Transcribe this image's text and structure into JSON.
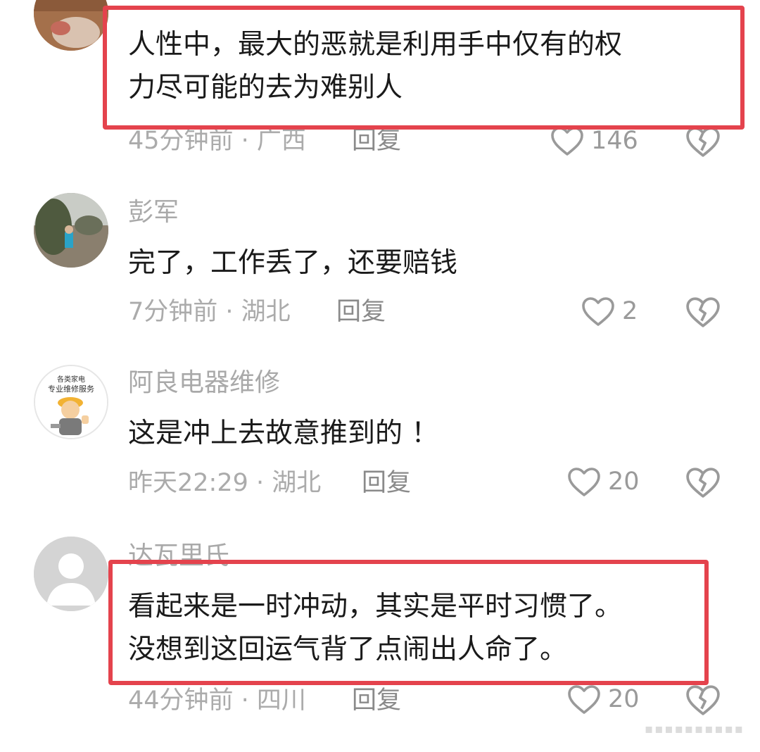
{
  "comments": [
    {
      "author": "",
      "text_lines": [
        "人性中，最大的恶就是利用手中仅有的权",
        "力尽可能的去为难别人"
      ],
      "time_location": "45分钟前 · 广西",
      "reply": "回复",
      "likes": "146",
      "highlighted": true
    },
    {
      "author": "彭军",
      "text_lines": [
        "完了，工作丢了，还要赔钱"
      ],
      "time_location": "7分钟前 · 湖北",
      "reply": "回复",
      "likes": "2",
      "highlighted": false
    },
    {
      "author": "阿良电器维修",
      "avatar_text": [
        "各类家电",
        "专业维修服务"
      ],
      "text_lines": [
        "这是冲上去故意推到的 ！"
      ],
      "time_location": "昨天22:29 · 湖北",
      "reply": "回复",
      "likes": "20",
      "highlighted": false
    },
    {
      "author": "达瓦里氏",
      "text_lines": [
        "看起来是一时冲动，其实是平时习惯了。",
        "没想到这回运气背了点闹出人命了。"
      ],
      "time_location": "44分钟前 · 四川",
      "reply": "回复",
      "likes": "20",
      "highlighted": true
    }
  ],
  "colors": {
    "highlight_border": "#e4434d",
    "secondary_text": "#a9a9a9",
    "primary_text": "#1a1a1a"
  },
  "icons": [
    "heart-outline-icon",
    "broken-heart-icon"
  ]
}
